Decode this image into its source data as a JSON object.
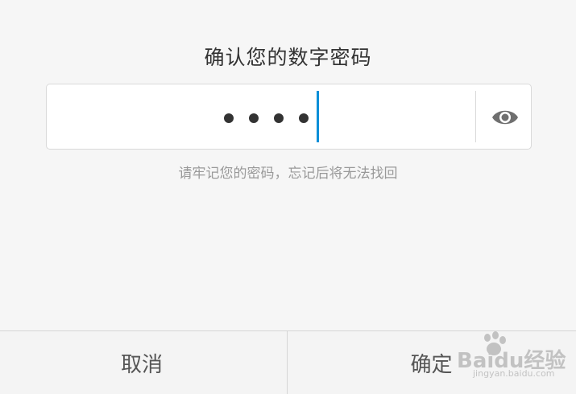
{
  "dialog": {
    "title": "确认您的数字密码",
    "pin": {
      "entered_digits": 4,
      "masked_value": "••••"
    },
    "toggle_visibility_icon": "eye-icon",
    "hint": "请牢记您的密码，忘记后将无法找回",
    "buttons": {
      "cancel_label": "取消",
      "confirm_label": "确定"
    }
  },
  "watermark": {
    "brand_text": "Baidu经验",
    "url_text": "jingyan.baidu.com"
  },
  "colors": {
    "background": "#f6f6f6",
    "caret": "#0a8fd8",
    "text_primary": "#333333",
    "text_hint": "#999999"
  }
}
